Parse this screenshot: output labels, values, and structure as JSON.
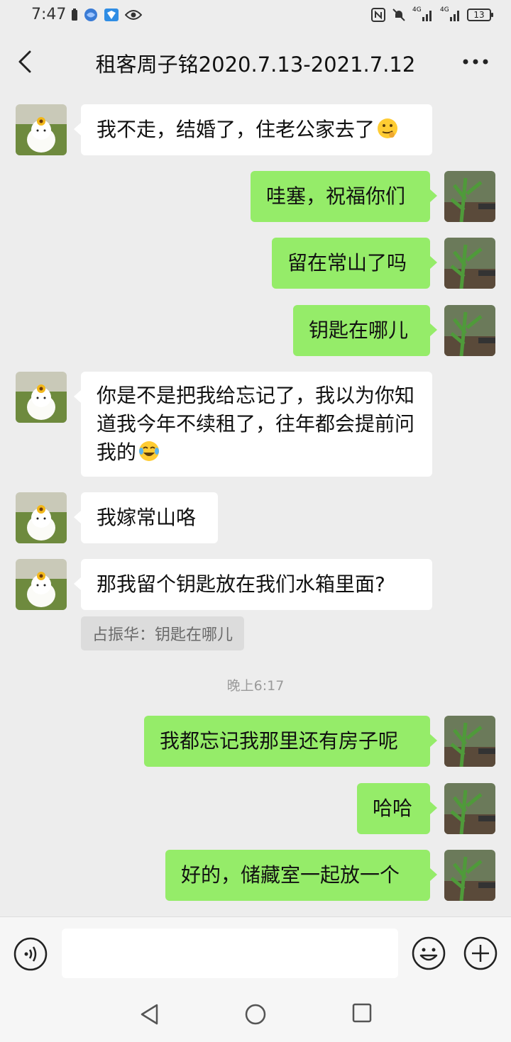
{
  "status_bar": {
    "time": "7:47",
    "battery": "13",
    "signal_label_1": "4G",
    "signal_label_2": "4G"
  },
  "header": {
    "title": "租客周子铭2020.7.13-2021.7.12"
  },
  "messages": [
    {
      "side": "in",
      "text": "我不走，结婚了，住老公家去了",
      "emoji": "thinking-face"
    },
    {
      "side": "out",
      "text": "哇塞，祝福你们"
    },
    {
      "side": "out",
      "text": "留在常山了吗"
    },
    {
      "side": "out",
      "text": "钥匙在哪儿"
    },
    {
      "side": "in",
      "text": "你是不是把我给忘记了，我以为你知道我今年不续租了，往年都会提前问我的",
      "emoji": "tears-of-joy"
    },
    {
      "side": "in",
      "text": "我嫁常山咯"
    },
    {
      "side": "in",
      "text": "那我留个钥匙放在我们水箱里面?",
      "quote": "占振华：钥匙在哪儿"
    },
    {
      "side": "out",
      "text": "我都忘记我那里还有房子呢"
    },
    {
      "side": "out",
      "text": "哈哈"
    },
    {
      "side": "out",
      "text": "好的，储藏室一起放一个"
    }
  ],
  "timestamp": "晚上6:17",
  "input": {
    "placeholder": ""
  },
  "colors": {
    "background": "#ededed",
    "bubble_out": "#95ec69",
    "bubble_in": "#ffffff"
  },
  "icons": [
    "back-chevron-icon",
    "more-dots-icon",
    "voice-icon",
    "emoji-icon",
    "plus-icon",
    "nav-back-icon",
    "nav-home-icon",
    "nav-recent-icon"
  ]
}
